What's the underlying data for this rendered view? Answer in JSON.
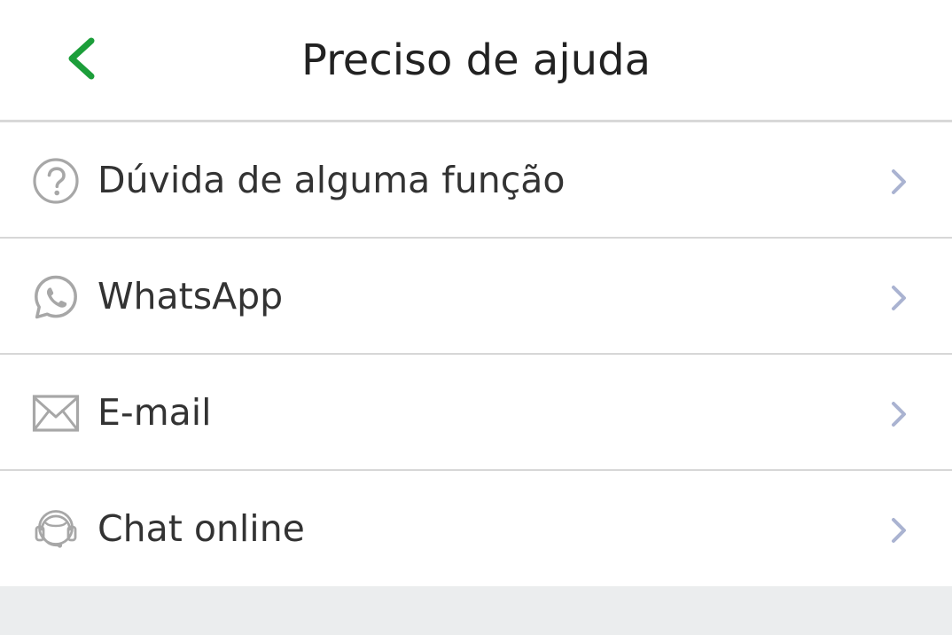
{
  "header": {
    "title": "Preciso de ajuda",
    "back_icon": "chevron-left-icon",
    "accent_color": "#1c9e3a"
  },
  "menu": {
    "items": [
      {
        "label": "Dúvida de alguma função",
        "icon": "question-circle-icon"
      },
      {
        "label": "WhatsApp",
        "icon": "whatsapp-icon"
      },
      {
        "label": "E-mail",
        "icon": "envelope-icon"
      },
      {
        "label": "Chat online",
        "icon": "headset-icon"
      }
    ],
    "chevron_icon": "chevron-right-icon"
  }
}
